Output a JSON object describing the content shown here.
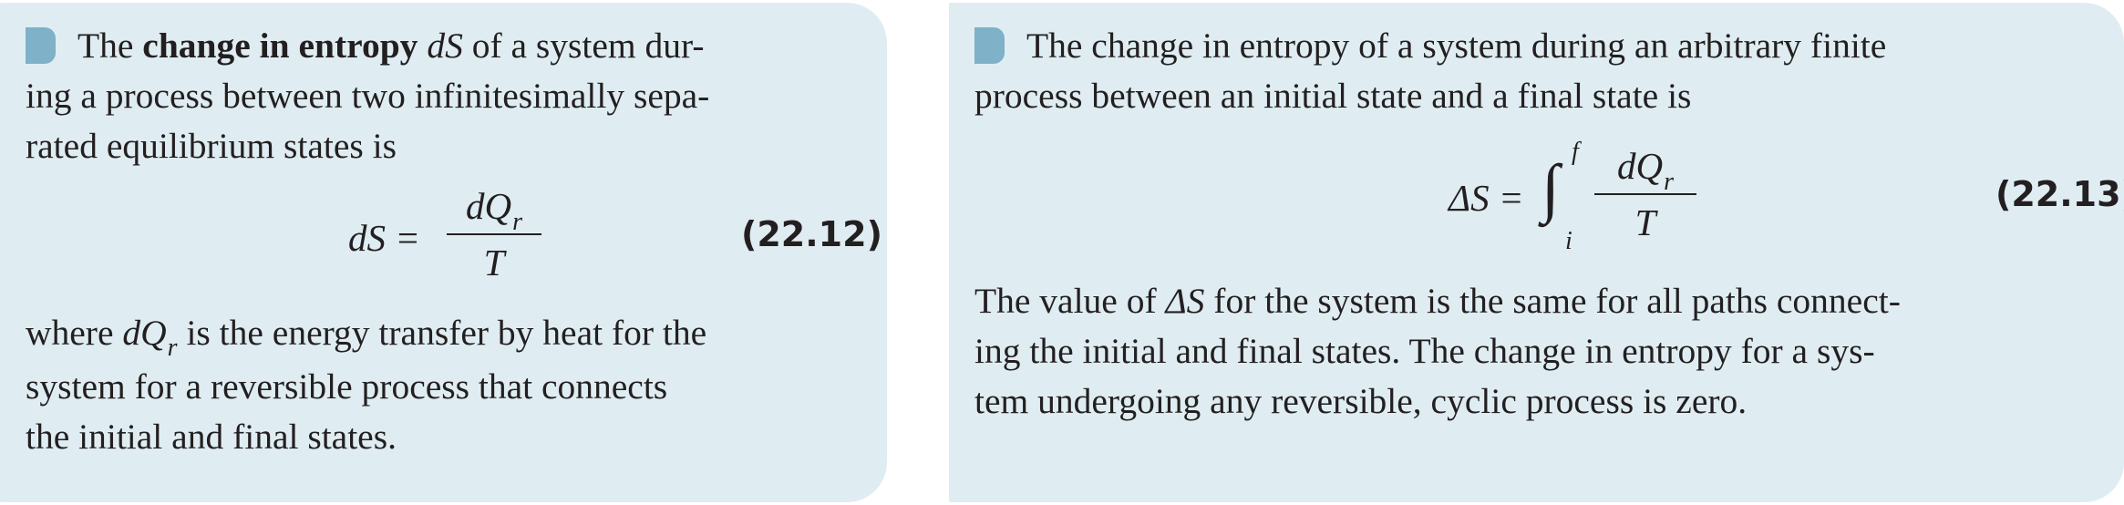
{
  "left": {
    "para1_pre": "The ",
    "para1_bold": "change in entropy",
    "para1_var": "dS",
    "para1_line1_rest": " of a system dur-",
    "para1_line2": "ing a process between two infinitesimally sepa-",
    "para1_line3": "rated equilibrium states is",
    "eq": {
      "lhs": "dS =",
      "num_d": "dQ",
      "num_sub": "r",
      "den": "T",
      "number": "(22.12)"
    },
    "para2_pre": "where ",
    "para2_var": "dQ",
    "para2_sub": "r",
    "para2_line1_rest": " is the energy transfer by heat for the",
    "para2_line2": "system for a reversible process that connects",
    "para2_line3": "the initial and final states."
  },
  "right": {
    "para1_line1": "The change in entropy of a system during an arbitrary finite",
    "para1_line2": "process between an initial state and a final state is",
    "eq": {
      "lhs": "ΔS =",
      "integral": "∫",
      "upper": "f",
      "lower": "i",
      "num_d": "dQ",
      "num_sub": "r",
      "den": "T",
      "number": "(22.13)"
    },
    "para2_pre": "The value of ",
    "para2_var": "ΔS",
    "para2_line1_rest": " for the system is the same for all paths connect-",
    "para2_line2": "ing the initial and final states. The change in entropy for a sys-",
    "para2_line3": "tem undergoing any reversible, cyclic process is zero."
  },
  "colors": {
    "panel_background": "#dfedf2",
    "marker": "#7fb1c8",
    "text": "#231f20"
  }
}
